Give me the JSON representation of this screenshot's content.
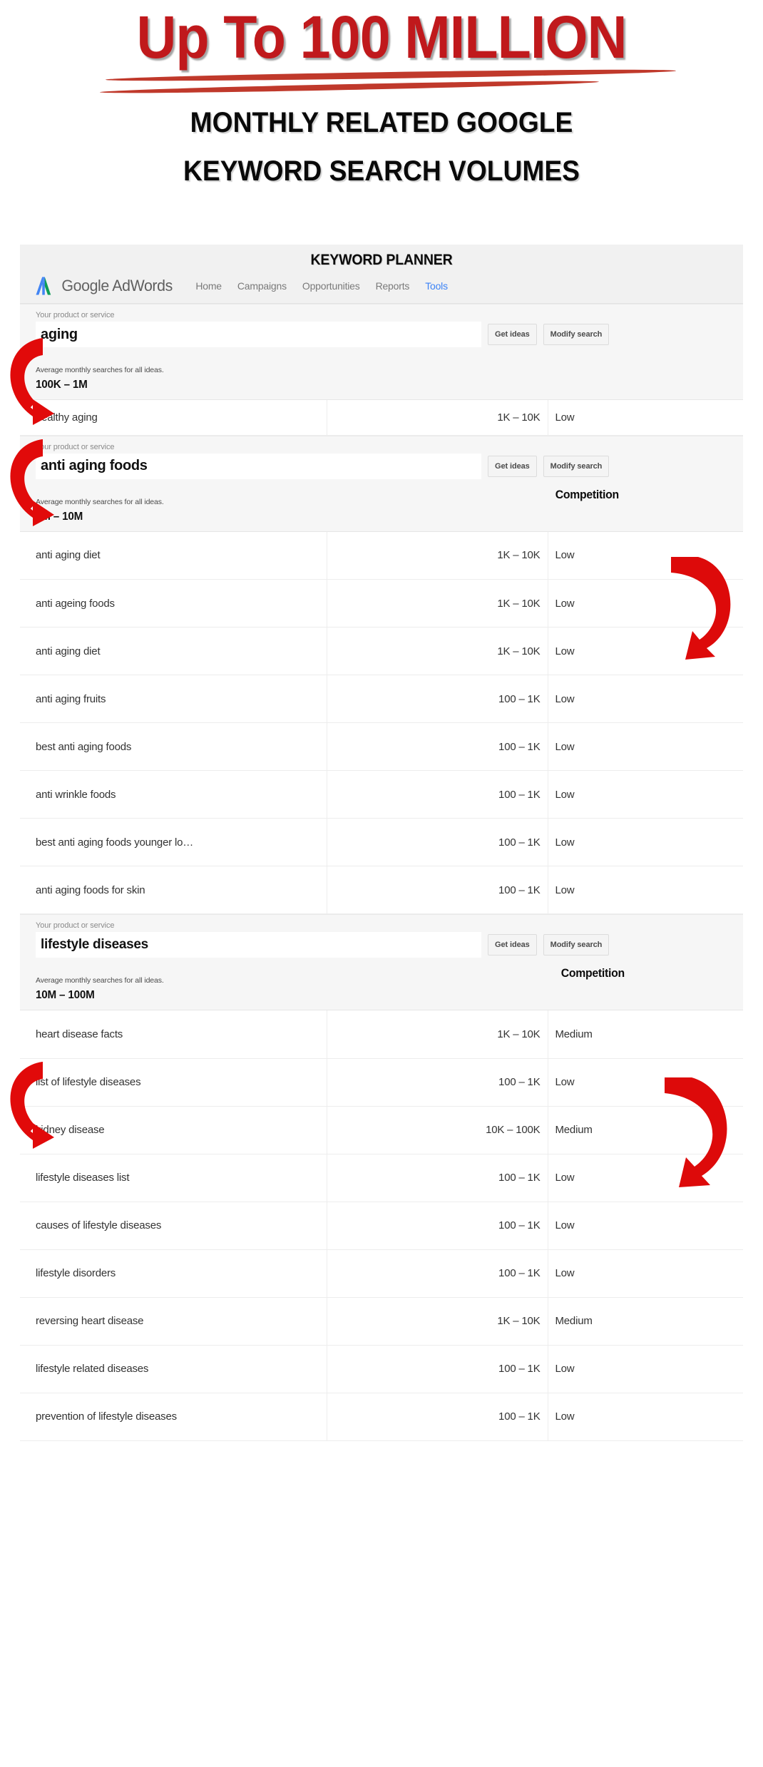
{
  "hero": {
    "title": "Up To 100 MILLION",
    "subtitle_line1": "MONTHLY RELATED GOOGLE",
    "subtitle_line2": "KEYWORD SEARCH VOLUMES",
    "title_color": "#c0191c",
    "underline_color": "#c0392b",
    "subtitle_color": "#0a0a0a"
  },
  "panel": {
    "planner_title": "KEYWORD PLANNER",
    "brand": {
      "google": "Google",
      "adwords": "AdWords",
      "logo_icon": "adwords-a-logo-icon",
      "logo_blue": "#4285f4",
      "logo_green": "#0f9d58"
    },
    "nav": [
      {
        "label": "Home",
        "active": false
      },
      {
        "label": "Campaigns",
        "active": false
      },
      {
        "label": "Opportunities",
        "active": false
      },
      {
        "label": "Reports",
        "active": false
      },
      {
        "label": "Tools",
        "active": true
      }
    ],
    "nav_active_color": "#3c83f6",
    "labels": {
      "product_or_service": "Your product or service",
      "average_monthly": "Average monthly searches for all ideas.",
      "get_ideas": "Get ideas",
      "modify_search": "Modify search",
      "competition": "Competition"
    },
    "arrow_color": "#e10a0a"
  },
  "sections": [
    {
      "query": "aging",
      "avg_value": "100K – 1M",
      "show_competition_flag": false,
      "rows": [
        {
          "keyword": "healthy aging",
          "volume": "1K – 10K",
          "competition": "Low"
        }
      ]
    },
    {
      "query": "anti aging foods",
      "avg_value": "1M – 10M",
      "show_competition_flag": true,
      "rows": [
        {
          "keyword": "anti aging diet",
          "volume": "1K – 10K",
          "competition": "Low"
        },
        {
          "keyword": "anti ageing foods",
          "volume": "1K – 10K",
          "competition": "Low"
        },
        {
          "keyword": "anti aging diet",
          "volume": "1K – 10K",
          "competition": "Low"
        },
        {
          "keyword": "anti aging fruits",
          "volume": "100 – 1K",
          "competition": "Low"
        },
        {
          "keyword": "best anti aging foods",
          "volume": "100 – 1K",
          "competition": "Low"
        },
        {
          "keyword": "anti wrinkle foods",
          "volume": "100 – 1K",
          "competition": "Low"
        },
        {
          "keyword": "best anti aging foods younger lo…",
          "volume": "100 – 1K",
          "competition": "Low"
        },
        {
          "keyword": "anti aging foods for skin",
          "volume": "100 – 1K",
          "competition": "Low"
        }
      ]
    },
    {
      "query": "lifestyle diseases",
      "avg_value": "10M – 100M",
      "show_competition_flag": true,
      "rows": [
        {
          "keyword": "heart disease facts",
          "volume": "1K – 10K",
          "competition": "Medium"
        },
        {
          "keyword": "list of lifestyle diseases",
          "volume": "100 – 1K",
          "competition": "Low"
        },
        {
          "keyword": "kidney disease",
          "volume": "10K – 100K",
          "competition": "Medium"
        },
        {
          "keyword": "lifestyle diseases list",
          "volume": "100 – 1K",
          "competition": "Low"
        },
        {
          "keyword": "causes of lifestyle diseases",
          "volume": "100 – 1K",
          "competition": "Low"
        },
        {
          "keyword": "lifestyle disorders",
          "volume": "100 – 1K",
          "competition": "Low"
        },
        {
          "keyword": "reversing heart disease",
          "volume": "1K – 10K",
          "competition": "Medium"
        },
        {
          "keyword": "lifestyle related diseases",
          "volume": "100 – 1K",
          "competition": "Low"
        },
        {
          "keyword": "prevention of lifestyle diseases",
          "volume": "100 – 1K",
          "competition": "Low"
        }
      ]
    }
  ]
}
